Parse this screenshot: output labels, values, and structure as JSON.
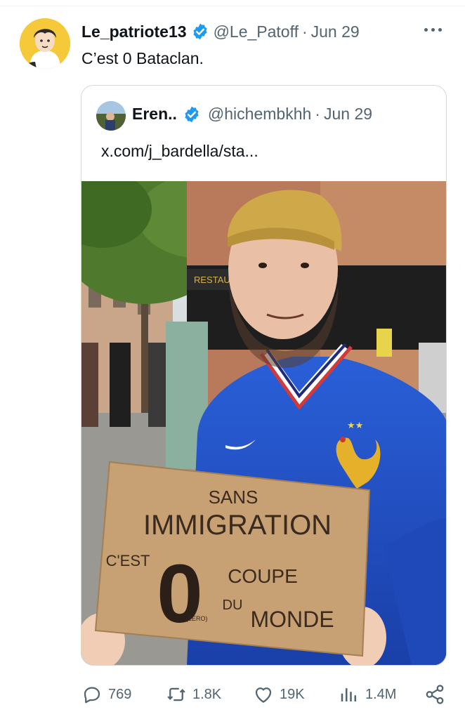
{
  "tweet": {
    "display_name": "Le_patriote13",
    "handle": "@Le_Patoff",
    "separator": "·",
    "date": "Jun 29",
    "text": "C’est 0 Bataclan."
  },
  "quote": {
    "display_name": "Eren..",
    "handle": "@hichembkhh",
    "separator": "·",
    "date": "Jun 29",
    "text": "x.com/j_bardella/sta...",
    "sign": {
      "line1": "SANS",
      "line2": "IMMIGRATION",
      "line3": "C'EST",
      "big": "0",
      "small": "(ZERO)",
      "line4": "COUPE",
      "line5": "DU",
      "line6": "MONDE"
    },
    "storefront": "RESTAURANT"
  },
  "actions": {
    "replies": "769",
    "retweets": "1.8K",
    "likes": "19K",
    "views": "1.4M"
  },
  "colors": {
    "verified": "#1d9bf0",
    "secondary_text": "#536471",
    "primary_text": "#0f1419",
    "border": "#cfd9de",
    "jersey": "#1f4fc9"
  },
  "icons": {
    "verified": "verified-badge-icon",
    "more": "more-icon",
    "reply": "reply-icon",
    "retweet": "retweet-icon",
    "like": "heart-icon",
    "views": "views-icon",
    "share": "share-icon"
  }
}
